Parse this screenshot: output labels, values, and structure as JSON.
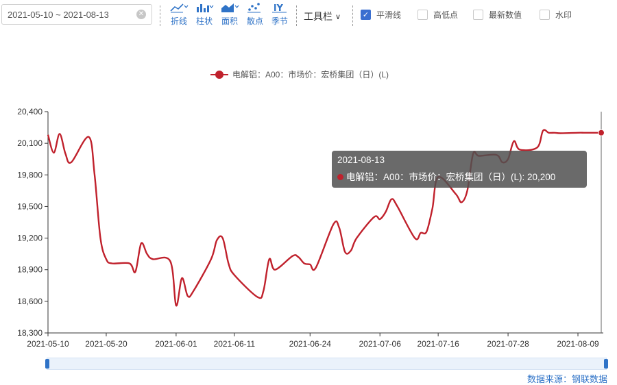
{
  "toolbar": {
    "date_range": "2021-05-10 ~ 2021-08-13",
    "chart_types": [
      {
        "label": "折线",
        "icon": "line-chart-icon"
      },
      {
        "label": "柱状",
        "icon": "bar-chart-icon"
      },
      {
        "label": "面积",
        "icon": "area-chart-icon"
      },
      {
        "label": "散点",
        "icon": "scatter-chart-icon"
      },
      {
        "label": "季节",
        "icon": "season-chart-icon"
      }
    ],
    "tools_label": "工具栏",
    "checkboxes": [
      {
        "label": "平滑线",
        "checked": true
      },
      {
        "label": "高低点",
        "checked": false
      },
      {
        "label": "最新数值",
        "checked": false
      },
      {
        "label": "水印",
        "checked": false
      }
    ]
  },
  "tooltip": {
    "date": "2021-08-13",
    "text": "电解铝：A00：市场价：宏桥集团（日）(L): 20,200"
  },
  "source": "数据来源：钢联数据",
  "colors": {
    "series": "#c0212c",
    "accent": "#2f73c7"
  },
  "chart_data": {
    "type": "line",
    "legend": [
      "电解铝：A00：市场价：宏桥集团（日）(L)"
    ],
    "ylim": [
      18300,
      20400
    ],
    "yticks": [
      "20,400",
      "20,100",
      "19,800",
      "19,500",
      "19,200",
      "18,900",
      "18,600",
      "18,300"
    ],
    "ytick_values": [
      20400,
      20100,
      19800,
      19500,
      19200,
      18900,
      18600,
      18300
    ],
    "xticks": [
      "2021-05-10",
      "2021-05-20",
      "2021-06-01",
      "2021-06-11",
      "2021-06-24",
      "2021-07-06",
      "2021-07-16",
      "2021-07-28",
      "2021-08-09"
    ],
    "smooth": true,
    "grid": false,
    "series": [
      {
        "name": "电解铝：A00：市场价：宏桥集团（日）(L)",
        "x": [
          "2021-05-10",
          "2021-05-11",
          "2021-05-12",
          "2021-05-13",
          "2021-05-14",
          "2021-05-17",
          "2021-05-18",
          "2021-05-19",
          "2021-05-20",
          "2021-05-21",
          "2021-05-24",
          "2021-05-25",
          "2021-05-26",
          "2021-05-27",
          "2021-05-28",
          "2021-05-31",
          "2021-06-01",
          "2021-06-02",
          "2021-06-03",
          "2021-06-04",
          "2021-06-07",
          "2021-06-08",
          "2021-06-09",
          "2021-06-10",
          "2021-06-11",
          "2021-06-15",
          "2021-06-16",
          "2021-06-17",
          "2021-06-18",
          "2021-06-21",
          "2021-06-22",
          "2021-06-23",
          "2021-06-24",
          "2021-06-25",
          "2021-06-28",
          "2021-06-29",
          "2021-06-30",
          "2021-07-01",
          "2021-07-02",
          "2021-07-05",
          "2021-07-06",
          "2021-07-07",
          "2021-07-08",
          "2021-07-09",
          "2021-07-12",
          "2021-07-13",
          "2021-07-14",
          "2021-07-15",
          "2021-07-16",
          "2021-07-19",
          "2021-07-20",
          "2021-07-21",
          "2021-07-22",
          "2021-07-23",
          "2021-07-26",
          "2021-07-27",
          "2021-07-28",
          "2021-07-29",
          "2021-07-30",
          "2021-08-02",
          "2021-08-03",
          "2021-08-04",
          "2021-08-05",
          "2021-08-06",
          "2021-08-09",
          "2021-08-10",
          "2021-08-11",
          "2021-08-12",
          "2021-08-13"
        ],
        "values": [
          20180,
          20010,
          20190,
          20000,
          19920,
          20160,
          19800,
          19200,
          19000,
          18960,
          18960,
          18880,
          19150,
          19050,
          19000,
          18980,
          18560,
          18820,
          18650,
          18700,
          19000,
          19180,
          19200,
          18960,
          18850,
          18640,
          18700,
          19000,
          18900,
          19030,
          19020,
          18960,
          18950,
          18920,
          19330,
          19300,
          19070,
          19080,
          19200,
          19400,
          19380,
          19450,
          19570,
          19500,
          19200,
          19250,
          19260,
          19480,
          19780,
          19620,
          19540,
          19650,
          20000,
          19980,
          19990,
          19920,
          19950,
          20120,
          20040,
          20060,
          20220,
          20200,
          20200,
          20195,
          20200,
          20200,
          20200,
          20200,
          20200
        ]
      }
    ]
  }
}
